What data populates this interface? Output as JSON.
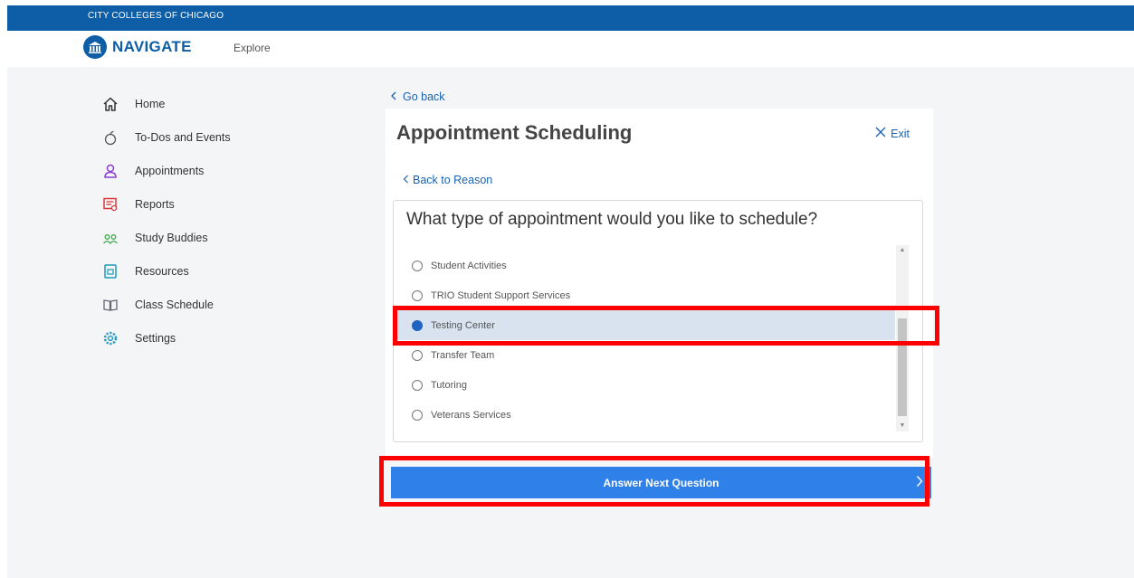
{
  "topbar": {
    "org": "CITY COLLEGES OF CHICAGO"
  },
  "header": {
    "app_name": "NAVIGATE",
    "explore_label": "Explore"
  },
  "sidebar": {
    "items": [
      {
        "label": "Home",
        "icon": "home-icon"
      },
      {
        "label": "To-Dos and Events",
        "icon": "apple-icon"
      },
      {
        "label": "Appointments",
        "icon": "person-icon"
      },
      {
        "label": "Reports",
        "icon": "report-icon"
      },
      {
        "label": "Study Buddies",
        "icon": "people-icon"
      },
      {
        "label": "Resources",
        "icon": "resources-icon"
      },
      {
        "label": "Class Schedule",
        "icon": "book-icon"
      },
      {
        "label": "Settings",
        "icon": "gear-icon"
      }
    ]
  },
  "main": {
    "go_back": "Go back",
    "title": "Appointment Scheduling",
    "exit_label": "Exit",
    "back_to_reason": "Back to Reason",
    "question": "What type of appointment would you like to schedule?",
    "options": [
      {
        "label": "Student Activities",
        "selected": false
      },
      {
        "label": "TRIO Student Support Services",
        "selected": false
      },
      {
        "label": "Testing Center",
        "selected": true
      },
      {
        "label": "Transfer Team",
        "selected": false
      },
      {
        "label": "Tutoring",
        "selected": false
      },
      {
        "label": "Veterans Services",
        "selected": false
      }
    ],
    "next_button": "Answer Next Question"
  },
  "colors": {
    "brand_blue": "#0d5ea6",
    "button_blue": "#2f80e8",
    "link_blue": "#1a62b0",
    "highlight_red": "#ff0000"
  }
}
